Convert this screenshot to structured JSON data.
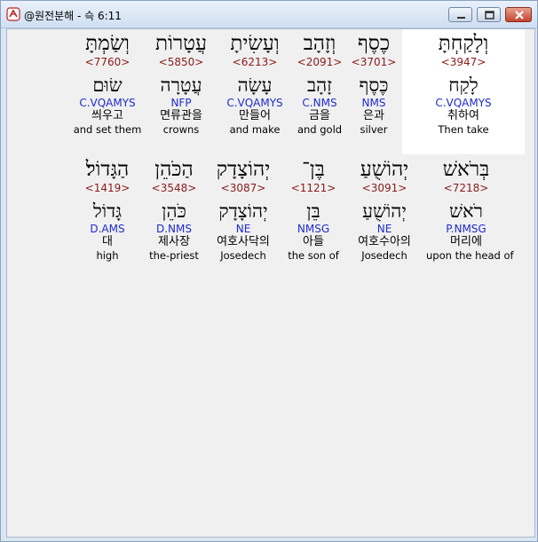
{
  "window": {
    "title": "@원전분해 - 슥 6:11"
  },
  "rows": [
    [
      {
        "heb": "וְלָקַחְתָּ",
        "strong": "<3947>",
        "lemma": "לָקַח",
        "parse": "C.VQAMYS",
        "kor": "취하여",
        "eng": "Then take"
      },
      {
        "heb": "כֶסֶף",
        "strong": "<3701>",
        "lemma": "כֶּסֶף",
        "parse": "NMS",
        "kor": "은과",
        "eng": "silver"
      },
      {
        "heb": "וְזָהָב",
        "strong": "<2091>",
        "lemma": "זָהָב",
        "parse": "C.NMS",
        "kor": "금을",
        "eng": "and gold"
      },
      {
        "heb": "וְעָשִׂיתָ",
        "strong": "<6213>",
        "lemma": "עָשָׂה",
        "parse": "C.VQAMYS",
        "kor": "만들어",
        "eng": "and make"
      },
      {
        "heb": "עֲטָרוֹת",
        "strong": "<5850>",
        "lemma": "עֲטָרָה",
        "parse": "NFP",
        "kor": "면류관을",
        "eng": "crowns"
      },
      {
        "heb": "וְשַׂמְתָּ",
        "strong": "<7760>",
        "lemma": "שׂוּם",
        "parse": "C.VQAMYS",
        "kor": "씌우고",
        "eng": "and set them"
      }
    ],
    [
      {
        "heb": "בְּרֹאשׁ",
        "strong": "<7218>",
        "lemma": "רֹאשׁ",
        "parse": "P.NMSG",
        "kor": "머리에",
        "eng": "upon the head of"
      },
      {
        "heb": "יְהוֹשֻׁעַ",
        "strong": "<3091>",
        "lemma": "יְהוֹשֻׁעַ",
        "parse": "NE",
        "kor": "여호수아의",
        "eng": "Josedech"
      },
      {
        "heb": "בֶּן־",
        "strong": "<1121>",
        "lemma": "בֵּן",
        "parse": "NMSG",
        "kor": "아들",
        "eng": "the son of"
      },
      {
        "heb": "יְהוֹצָדָק",
        "strong": "<3087>",
        "lemma": "יְהוֹצָדָק",
        "parse": "NE",
        "kor": "여호사닥의",
        "eng": "Josedech"
      },
      {
        "heb": "הַכֹּהֵן",
        "strong": "<3548>",
        "lemma": "כֹּהֵן",
        "parse": "D.NMS",
        "kor": "제사장",
        "eng": "the-priest"
      },
      {
        "heb": "הַגָּדוֹל׃",
        "strong": "<1419>",
        "lemma": "גָּדוֹל",
        "parse": "D.AMS",
        "kor": "대",
        "eng": "high"
      }
    ]
  ]
}
